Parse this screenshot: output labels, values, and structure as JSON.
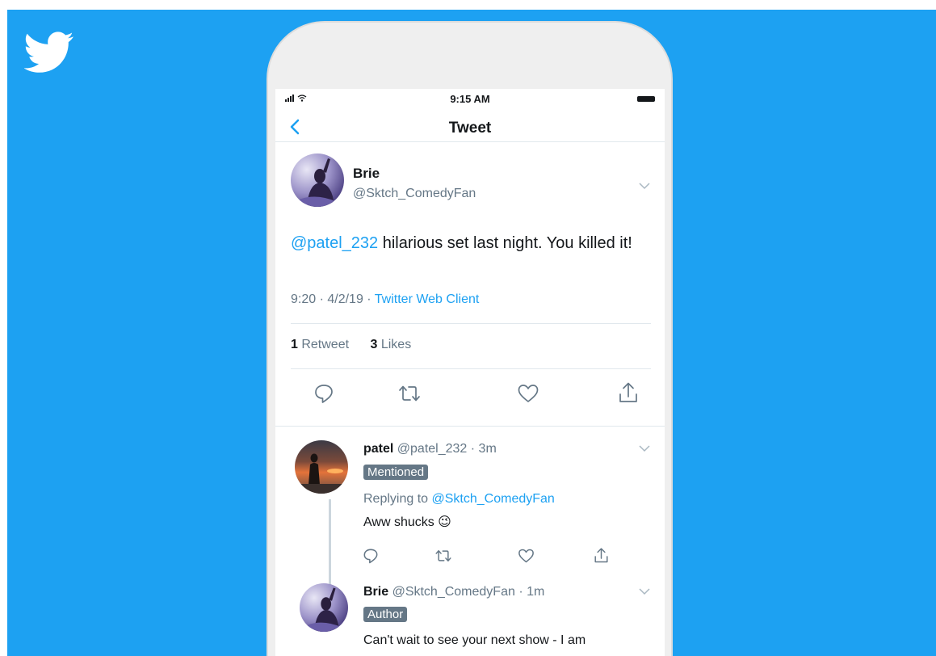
{
  "status": {
    "time": "9:15 AM"
  },
  "nav": {
    "title": "Tweet"
  },
  "tweet": {
    "name": "Brie",
    "handle": "@Sktch_ComedyFan",
    "mention": "@patel_232",
    "text": " hilarious set last night. You killed it!",
    "meta_prefix": "9:20 · 4/2/19 · ",
    "client": "Twitter Web Client",
    "retweet_count": "1",
    "retweet_label": " Retweet",
    "like_count": "3",
    "like_label": " Likes"
  },
  "replies": [
    {
      "name": "patel",
      "handle_time": " @patel_232 · 3m",
      "badge": "Mentioned",
      "replying_prefix": "Replying to ",
      "replying_handle": "@Sktch_ComedyFan",
      "text": "Aww shucks 😉"
    },
    {
      "name": "Brie",
      "handle_time": " @Sktch_ComedyFan · 1m",
      "badge": "Author",
      "text": "Can't wait to see your next show - I am"
    }
  ],
  "icons": {
    "logo": "twitter-bird-icon",
    "back": "chevron-left-icon",
    "more": "chevron-down-icon",
    "reply": "reply-icon",
    "retweet": "retweet-icon",
    "like": "heart-icon",
    "share": "share-icon"
  },
  "colors": {
    "background": "#1da1f2",
    "accent": "#1da1f2",
    "secondary_text": "#657786",
    "badge": "#657786"
  }
}
